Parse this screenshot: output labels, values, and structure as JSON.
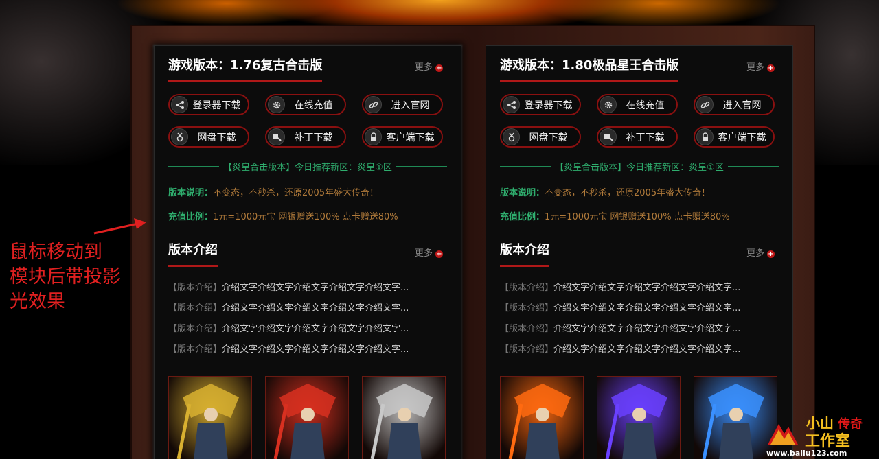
{
  "annotation": [
    "鼠标移动到",
    "模块后带投影",
    "光效果"
  ],
  "panels": [
    {
      "title": "游戏版本：1.76复古合击版",
      "more": "更多",
      "buttons": [
        {
          "label": "登录器下载",
          "icon": "share-icon"
        },
        {
          "label": "在线充值",
          "icon": "gear-icon"
        },
        {
          "label": "进入官网",
          "icon": "link-icon"
        },
        {
          "label": "网盘下载",
          "icon": "medal-icon"
        },
        {
          "label": "补丁下载",
          "icon": "patch-icon"
        },
        {
          "label": "客户端下载",
          "icon": "lock-icon"
        }
      ],
      "recommend": "【炎皇合击版本】今日推荐新区：炎皇①区",
      "desc_key": "版本说明：",
      "desc_val": "不变态，不秒杀，还原2005年盛大传奇！",
      "ratio_key": "充值比例：",
      "ratio_val": "1元=1000元宝 网银赠送100% 点卡赠送80%",
      "intro_title": "版本介绍",
      "intro_more": "更多",
      "intro_items": [
        {
          "tag": "【版本介绍】",
          "text": "介绍文字介绍文字介绍文字介绍文字介绍文字..."
        },
        {
          "tag": "【版本介绍】",
          "text": "介绍文字介绍文字介绍文字介绍文字介绍文字..."
        },
        {
          "tag": "【版本介绍】",
          "text": "介绍文字介绍文字介绍文字介绍文字介绍文字..."
        },
        {
          "tag": "【版本介绍】",
          "text": "介绍文字介绍文字介绍文字介绍文字介绍文字..."
        }
      ],
      "thumb_colors": [
        "#d8b030",
        "#d83020",
        "#c8c8c8"
      ]
    },
    {
      "title": "游戏版本：1.80极品星王合击版",
      "more": "更多",
      "buttons": [
        {
          "label": "登录器下载",
          "icon": "share-icon"
        },
        {
          "label": "在线充值",
          "icon": "gear-icon"
        },
        {
          "label": "进入官网",
          "icon": "link-icon"
        },
        {
          "label": "网盘下载",
          "icon": "medal-icon"
        },
        {
          "label": "补丁下载",
          "icon": "patch-icon"
        },
        {
          "label": "客户端下载",
          "icon": "lock-icon"
        }
      ],
      "recommend": "【炎皇合击版本】今日推荐新区：炎皇①区",
      "desc_key": "版本说明：",
      "desc_val": "不变态，不秒杀，还原2005年盛大传奇！",
      "ratio_key": "充值比例：",
      "ratio_val": "1元=1000元宝 网银赠送100% 点卡赠送80%",
      "intro_title": "版本介绍",
      "intro_more": "更多",
      "intro_items": [
        {
          "tag": "【版本介绍】",
          "text": "介绍文字介绍文字介绍文字介绍文字介绍文字..."
        },
        {
          "tag": "【版本介绍】",
          "text": "介绍文字介绍文字介绍文字介绍文字介绍文字..."
        },
        {
          "tag": "【版本介绍】",
          "text": "介绍文字介绍文字介绍文字介绍文字介绍文字..."
        },
        {
          "tag": "【版本介绍】",
          "text": "介绍文字介绍文字介绍文字介绍文字介绍文字..."
        }
      ],
      "thumb_colors": [
        "#ff6a10",
        "#6a40ff",
        "#3a90ff"
      ]
    }
  ],
  "logo": {
    "line1": "小山",
    "line1_accent": "传奇",
    "line2": "工作室",
    "url": "www.bailu123.com"
  },
  "colors": {
    "accent_red": "#b01818",
    "green": "#2fae6e",
    "gold": "#b07a3a"
  }
}
